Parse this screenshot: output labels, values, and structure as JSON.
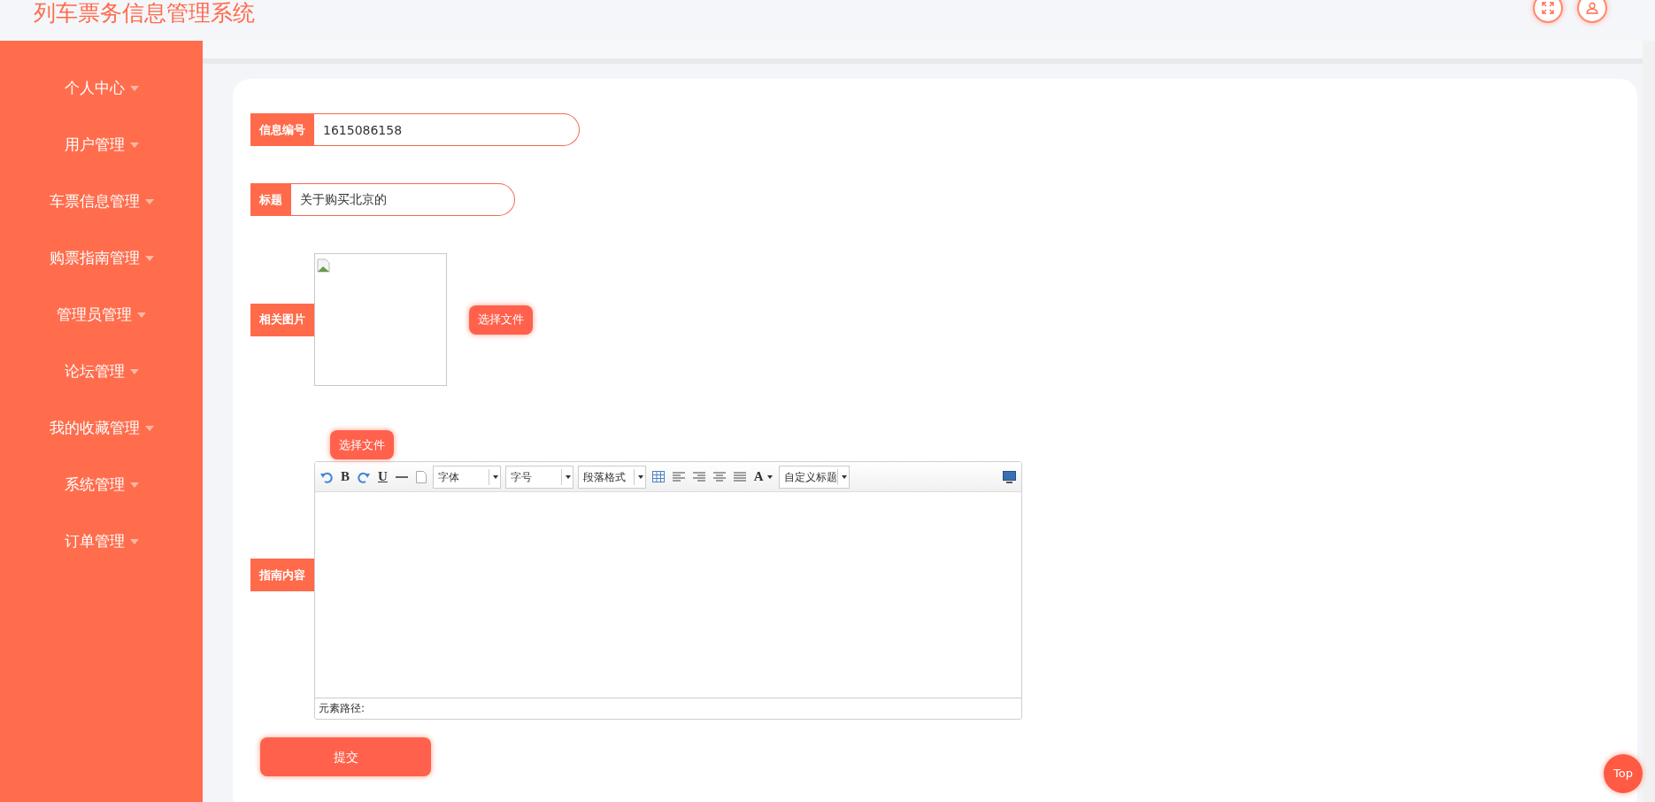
{
  "header": {
    "title": "列车票务信息管理系统"
  },
  "sidebar": {
    "items": [
      {
        "label": "个人中心"
      },
      {
        "label": "用户管理"
      },
      {
        "label": "车票信息管理"
      },
      {
        "label": "购票指南管理"
      },
      {
        "label": "管理员管理"
      },
      {
        "label": "论坛管理"
      },
      {
        "label": "我的收藏管理"
      },
      {
        "label": "系统管理"
      },
      {
        "label": "订单管理"
      }
    ]
  },
  "form": {
    "fields": [
      {
        "kind": "text",
        "label": "信息编号",
        "value": "1615086158"
      },
      {
        "kind": "text",
        "label": "标题",
        "value": "关于购买北京的"
      },
      {
        "kind": "image",
        "label": "相关图片",
        "button": "选择文件"
      },
      {
        "kind": "editor",
        "label": "指南内容",
        "button": "选择文件",
        "toolbar": [
          {
            "kind": "undo"
          },
          {
            "kind": "letter",
            "label": "B"
          },
          {
            "kind": "redo"
          },
          {
            "kind": "letter",
            "label": "U"
          },
          {
            "kind": "rule"
          },
          {
            "kind": "page"
          },
          {
            "kind": "select",
            "label": "字体"
          },
          {
            "kind": "select",
            "label": "字号"
          },
          {
            "kind": "select",
            "label": "段落格式"
          },
          {
            "kind": "table"
          },
          {
            "kind": "alignleft"
          },
          {
            "kind": "alignright"
          },
          {
            "kind": "aligncenter"
          },
          {
            "kind": "justify"
          },
          {
            "kind": "color",
            "label": "A"
          },
          {
            "kind": "select",
            "label": "自定义标题"
          },
          {
            "kind": "preview"
          }
        ],
        "status": "元素路径:"
      }
    ],
    "submit": "提交"
  },
  "back_to_top": "Top"
}
